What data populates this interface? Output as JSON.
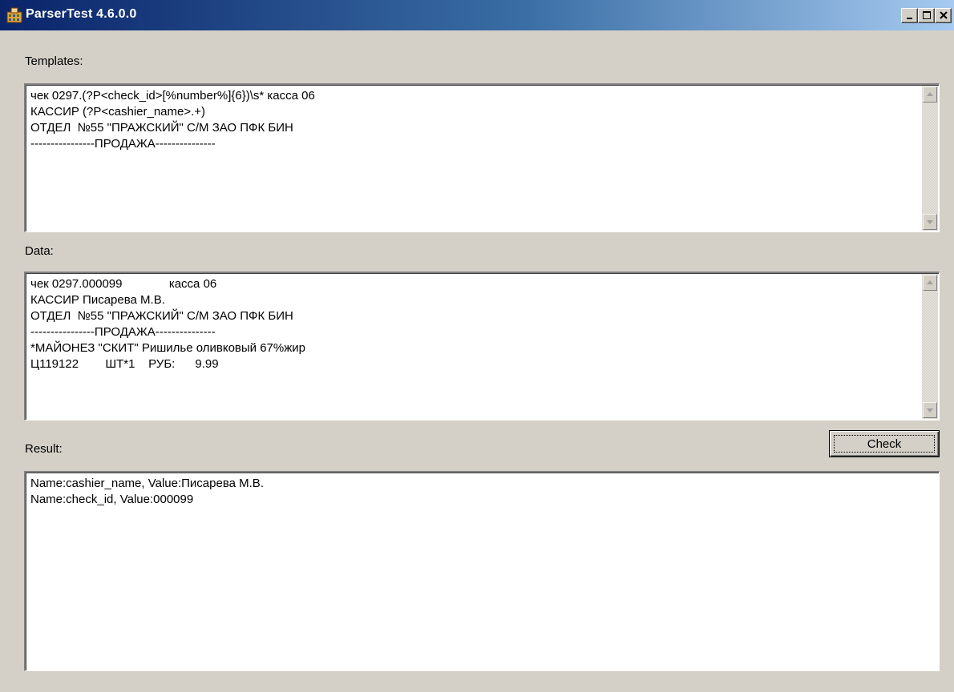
{
  "window": {
    "title": "ParserTest 4.6.0.0"
  },
  "title_controls": {
    "minimize_icon": "minimize-icon",
    "maximize_icon": "maximize-icon",
    "close_icon": "close-icon"
  },
  "templates": {
    "label": "Templates:",
    "text": "чек 0297.(?P<check_id>[%number%]{6})\\s* касса 06\nКАССИР (?P<cashier_name>.+)\nОТДЕЛ  №55 \"ПРАЖСКИЙ\" С/М ЗАО ПФК БИН\n----------------ПРОДАЖА---------------"
  },
  "data": {
    "label": "Data:",
    "text": "чек 0297.000099              касса 06\nКАССИР Писарева М.В.\nОТДЕЛ  №55 \"ПРАЖСКИЙ\" С/М ЗАО ПФК БИН\n----------------ПРОДАЖА---------------\n*МАЙОНЕЗ \"СКИТ\" Ришилье оливковый 67%жир\nЦ119122        ШТ*1    РУБ:      9.99"
  },
  "result": {
    "label": "Result:",
    "text": "Name:cashier_name, Value:Писарева М.В.\nName:check_id, Value:000099"
  },
  "actions": {
    "check_label": "Check"
  }
}
